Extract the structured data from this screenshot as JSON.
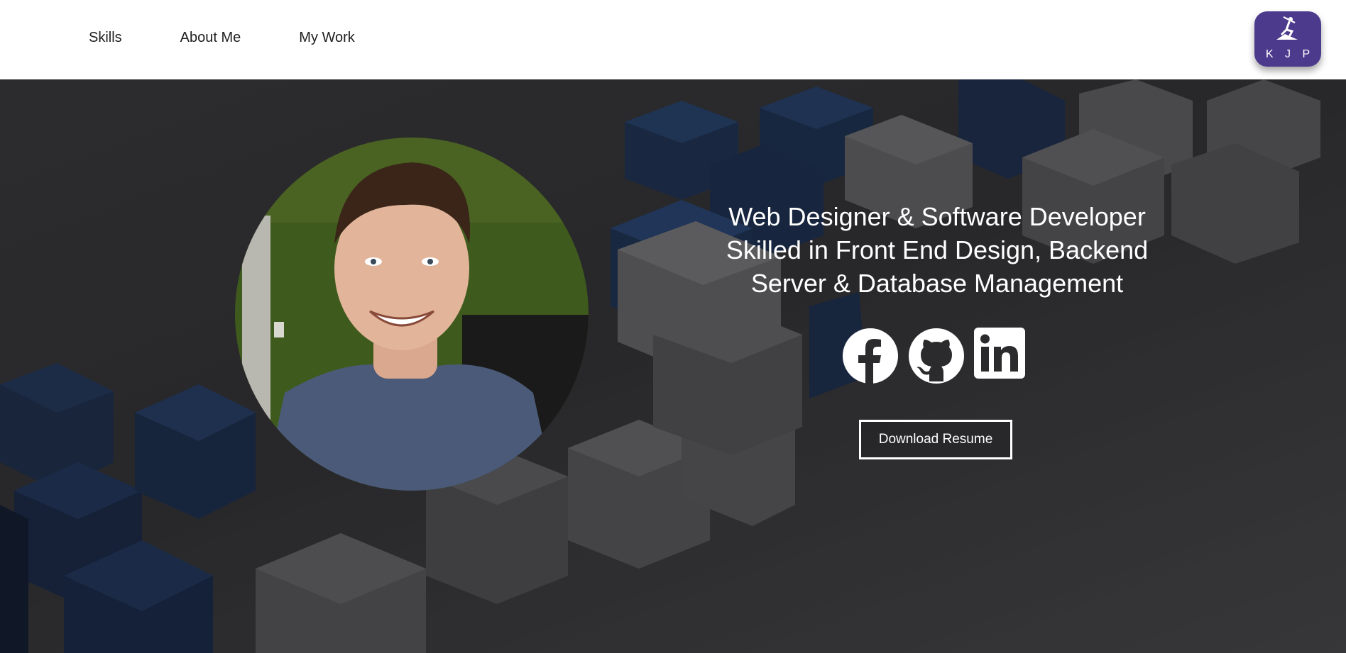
{
  "nav": {
    "items": [
      {
        "label": "Skills"
      },
      {
        "label": "About Me"
      },
      {
        "label": "My Work"
      }
    ]
  },
  "logo": {
    "text": "K J P",
    "icon": "miner-icon",
    "color": "#4c3a8d"
  },
  "hero": {
    "headline": [
      "Web Designer & Software Developer",
      "Skilled in Front End Design, Backend",
      "Server & Database Management"
    ],
    "socials": [
      {
        "icon": "facebook-icon"
      },
      {
        "icon": "github-icon"
      },
      {
        "icon": "linkedin-icon"
      }
    ],
    "resume_button": "Download Resume",
    "accent_blue": "#1c3357",
    "cube_gray": "#5a5a5c"
  }
}
